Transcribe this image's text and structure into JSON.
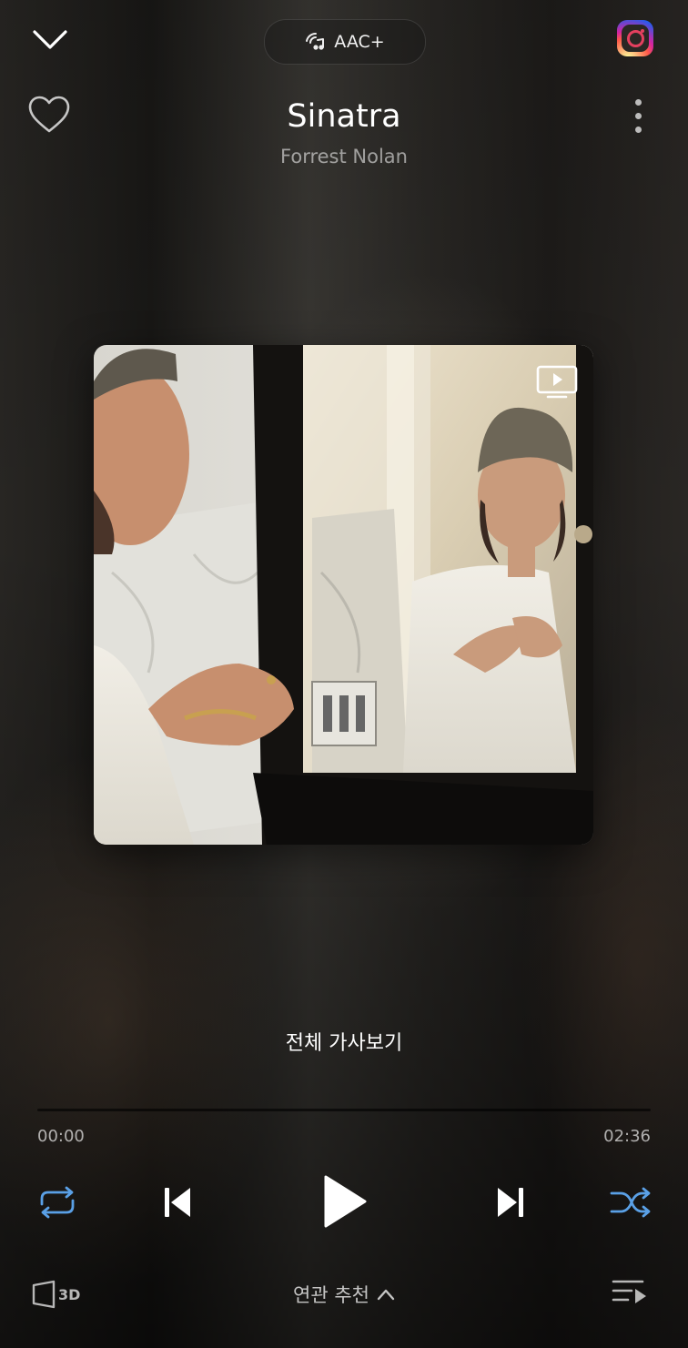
{
  "header": {
    "codec_label": "AAC+"
  },
  "track": {
    "title": "Sinatra",
    "artist": "Forrest Nolan"
  },
  "lyrics": {
    "label": "전체 가사보기"
  },
  "progress": {
    "current": "00:00",
    "total": "02:36",
    "fraction": 0.0
  },
  "bottom": {
    "three_d_label": "3D",
    "related_label": "연관 추천"
  },
  "colors": {
    "accent_blue": "#5aa0e6",
    "background": "#1b1917"
  },
  "icons": {
    "collapse": "chevron-down-icon",
    "codec": "audio-quality-icon",
    "share": "instagram-icon",
    "like": "heart-icon",
    "more": "more-vertical-icon",
    "video": "music-video-icon",
    "repeat": "repeat-icon",
    "prev": "skip-previous-icon",
    "play": "play-icon",
    "next": "skip-next-icon",
    "shuffle": "shuffle-icon",
    "sound_3d": "3d-sound-icon",
    "related": "chevron-up-icon",
    "playlist": "playlist-icon"
  }
}
